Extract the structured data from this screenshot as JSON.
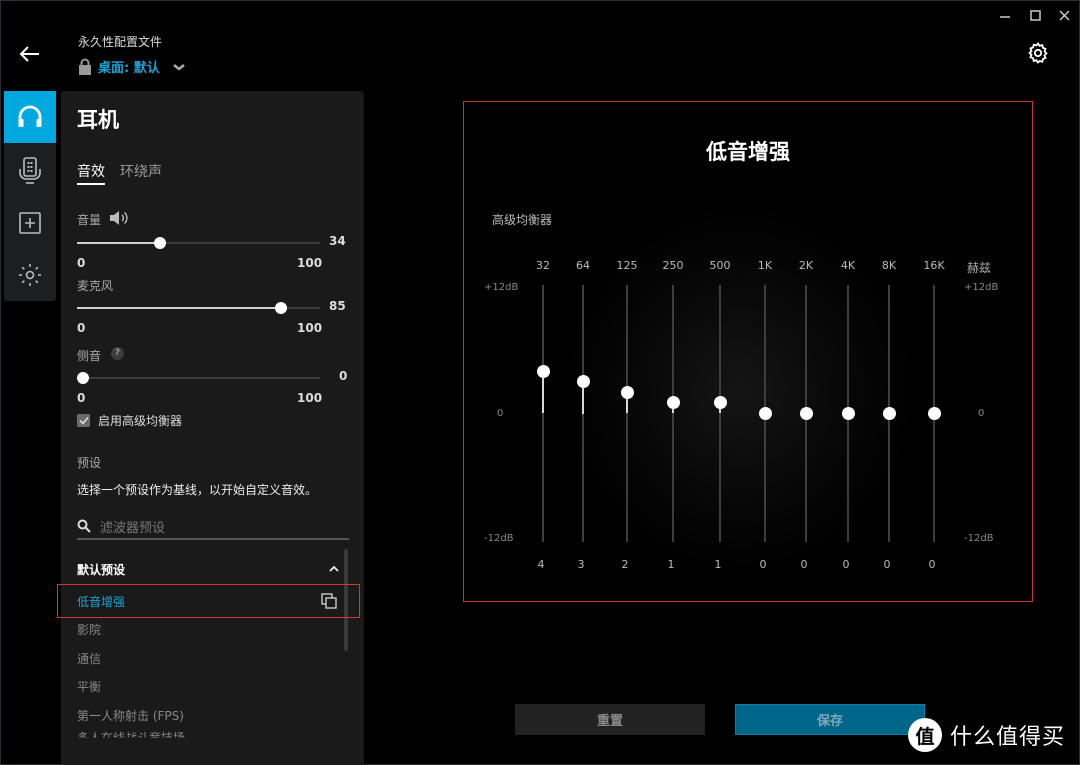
{
  "header": {
    "back_icon": "arrow-left-icon",
    "profile_label": "永久性配置文件",
    "profile_lock_icon": "lock-icon",
    "profile_name": "桌面: 默认",
    "profile_dropdown_icon": "chevron-down-icon",
    "window_controls": [
      "minimize",
      "maximize",
      "close"
    ],
    "settings_icon": "gear-icon"
  },
  "rail": {
    "items": [
      {
        "name": "headset",
        "icon": "headphones-icon",
        "active": true
      },
      {
        "name": "microphone",
        "icon": "microphone-icon",
        "active": false
      },
      {
        "name": "add",
        "icon": "plus-box-icon",
        "active": false
      },
      {
        "name": "lighting",
        "icon": "sun-icon",
        "active": false
      }
    ],
    "accent_color": "#00a8e0"
  },
  "panel": {
    "title": "耳机",
    "tabs": [
      {
        "label": "音效",
        "active": true
      },
      {
        "label": "环绕声",
        "active": false
      }
    ],
    "volume": {
      "label": "音量",
      "value": "34",
      "value_fraction": 0.34,
      "min": "0",
      "max": "100",
      "icon": "speaker-icon"
    },
    "microphone": {
      "label": "麦克风",
      "value": "85",
      "value_fraction": 0.85,
      "min": "0",
      "max": "100"
    },
    "sidetone": {
      "label": "侧音",
      "value": "0",
      "value_fraction": 0.0,
      "min": "0",
      "max": "100",
      "help": "?"
    },
    "advanced_eq": {
      "label": "启用高级均衡器",
      "checked": true
    },
    "presets": {
      "heading": "预设",
      "description": "选择一个预设作为基线，以开始自定义音效。",
      "search_placeholder": "滤波器预设",
      "group_label": "默认预设",
      "items": [
        {
          "label": "低音增强",
          "active": true
        },
        {
          "label": "影院",
          "active": false
        },
        {
          "label": "通信",
          "active": false
        },
        {
          "label": "平衡",
          "active": false
        },
        {
          "label": "第一人称射击 (FPS)",
          "active": false
        },
        {
          "label": "多人在线战斗竞技场",
          "active": false
        }
      ]
    }
  },
  "eq": {
    "title": "低音增强",
    "subtitle": "高级均衡器",
    "unit_label": "赫兹",
    "db_top": "+12dB",
    "db_mid": "0",
    "db_bottom": "-12dB",
    "bands": [
      {
        "freq": "32",
        "gain": "4",
        "gain_db": 4
      },
      {
        "freq": "64",
        "gain": "3",
        "gain_db": 3
      },
      {
        "freq": "125",
        "gain": "2",
        "gain_db": 2
      },
      {
        "freq": "250",
        "gain": "1",
        "gain_db": 1
      },
      {
        "freq": "500",
        "gain": "1",
        "gain_db": 1
      },
      {
        "freq": "1K",
        "gain": "0",
        "gain_db": 0
      },
      {
        "freq": "2K",
        "gain": "0",
        "gain_db": 0
      },
      {
        "freq": "4K",
        "gain": "0",
        "gain_db": 0
      },
      {
        "freq": "8K",
        "gain": "0",
        "gain_db": 0
      },
      {
        "freq": "16K",
        "gain": "0",
        "gain_db": 0
      }
    ],
    "range_db": [
      -12,
      12
    ]
  },
  "actions": {
    "reset_label": "重置",
    "save_label": "保存"
  },
  "watermark": {
    "badge": "值",
    "text": "什么值得买"
  }
}
